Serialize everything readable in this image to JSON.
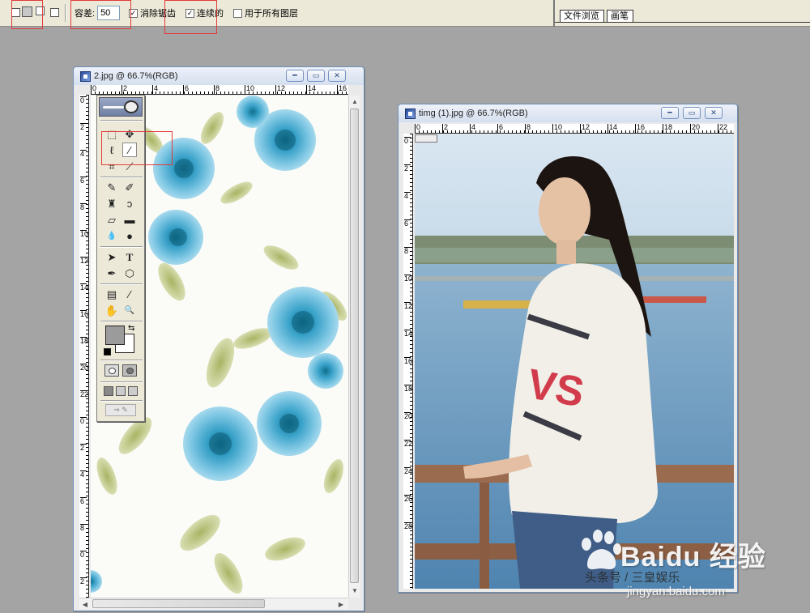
{
  "options_bar": {
    "tolerance_label": "容差:",
    "tolerance_value": "50",
    "anti_alias_label": "消除锯齿",
    "anti_alias_checked": true,
    "contiguous_label": "连续的",
    "contiguous_checked": true,
    "all_layers_label": "用于所有图层",
    "all_layers_checked": false
  },
  "palette_well": {
    "tabs": [
      {
        "label": "文件浏览"
      },
      {
        "label": "画笔"
      }
    ]
  },
  "windows": [
    {
      "title": "2.jpg @ 66.7%(RGB)",
      "ruler_h": [
        "0",
        "2",
        "4",
        "6",
        "8",
        "10",
        "12",
        "14",
        "16"
      ],
      "ruler_v": [
        "0",
        "2",
        "4",
        "6",
        "8",
        "10",
        "12",
        "14",
        "16",
        "18",
        "20",
        "22",
        "0",
        "2",
        "4",
        "6",
        "8",
        "0",
        "2",
        "4"
      ]
    },
    {
      "title": "timg (1).jpg @ 66.7%(RGB)",
      "ruler_h": [
        "0",
        "2",
        "4",
        "6",
        "8",
        "10",
        "12",
        "14",
        "16",
        "18",
        "20",
        "22"
      ],
      "ruler_v": [
        "0",
        "2",
        "4",
        "6",
        "8",
        "10",
        "12",
        "14",
        "16",
        "18",
        "20",
        "22",
        "24",
        "26",
        "28"
      ]
    }
  ],
  "toolbox": {
    "tools": [
      {
        "name": "marquee-tool",
        "glyph": "⬚"
      },
      {
        "name": "move-tool",
        "glyph": "✥"
      },
      {
        "name": "lasso-tool",
        "glyph": "ℓ"
      },
      {
        "name": "magic-wand-tool",
        "glyph": "⁄"
      },
      {
        "name": "crop-tool",
        "glyph": "⌗"
      },
      {
        "name": "slice-tool",
        "glyph": "⟋"
      },
      {
        "name": "healing-brush-tool",
        "glyph": "✎"
      },
      {
        "name": "brush-tool",
        "glyph": "✐"
      },
      {
        "name": "clone-stamp-tool",
        "glyph": "♜"
      },
      {
        "name": "history-brush-tool",
        "glyph": "ↄ"
      },
      {
        "name": "eraser-tool",
        "glyph": "▱"
      },
      {
        "name": "gradient-tool",
        "glyph": "▬"
      },
      {
        "name": "blur-tool",
        "glyph": "💧"
      },
      {
        "name": "dodge-tool",
        "glyph": "●"
      },
      {
        "name": "path-selection-tool",
        "glyph": "➤"
      },
      {
        "name": "type-tool",
        "glyph": "T"
      },
      {
        "name": "pen-tool",
        "glyph": "✒"
      },
      {
        "name": "shape-tool",
        "glyph": "⬡"
      },
      {
        "name": "notes-tool",
        "glyph": "▤"
      },
      {
        "name": "eyedropper-tool",
        "glyph": "⁄"
      },
      {
        "name": "hand-tool",
        "glyph": "✋"
      },
      {
        "name": "zoom-tool",
        "glyph": "🔍"
      }
    ],
    "active_tool": "magic-wand-tool",
    "colors": {
      "foreground": "#9b9b9b",
      "background": "#ffffff"
    }
  },
  "colors": {
    "workspace": "#a4a4a4",
    "highlight_box": "#e23a3a"
  },
  "watermark": {
    "brand": "Baidu 经验",
    "author": "头条号 / 三皇娱乐",
    "url": "jingyan.baidu.com"
  }
}
